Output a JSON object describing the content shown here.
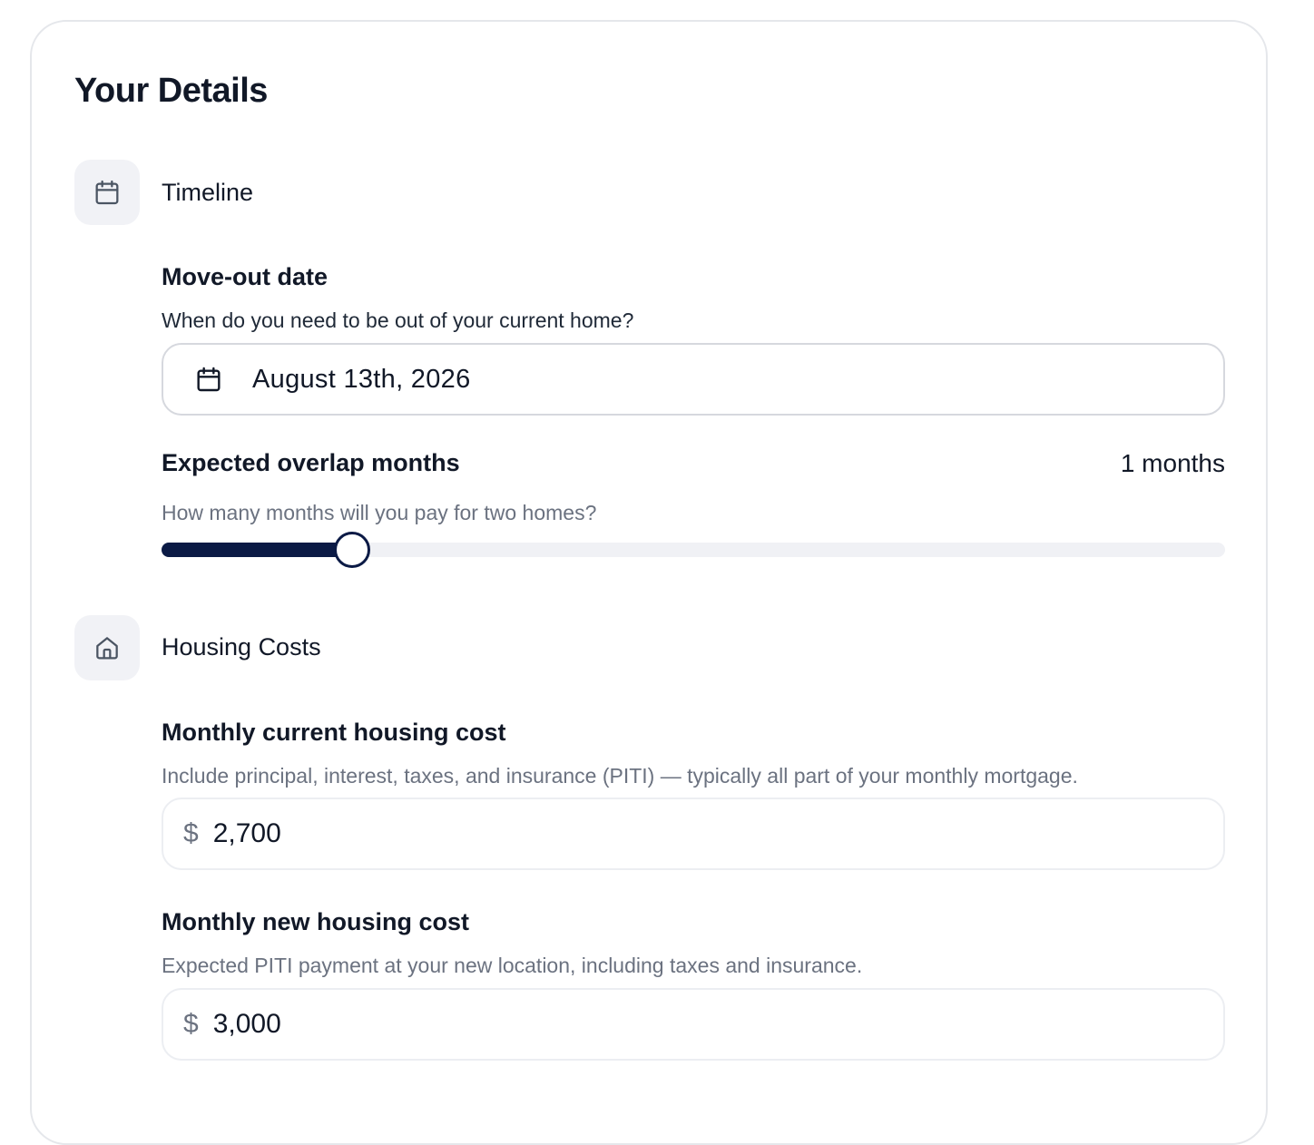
{
  "card": {
    "title": "Your Details"
  },
  "timeline": {
    "section_title": "Timeline",
    "icon": "calendar-icon",
    "move_out": {
      "label": "Move-out date",
      "help": "When do you need to be out of your current home?",
      "value": "August 13th, 2026",
      "icon": "calendar-icon"
    },
    "overlap": {
      "label": "Expected overlap months",
      "value_text": "1 months",
      "help": "How many months will you pay for two homes?",
      "slider_fraction": 0.179
    }
  },
  "housing": {
    "section_title": "Housing Costs",
    "icon": "home-icon",
    "current": {
      "label": "Monthly current housing cost",
      "help": "Include principal, interest, taxes, and insurance (PITI) — typically all part of your monthly mortgage.",
      "currency": "$",
      "value": "2,700"
    },
    "new": {
      "label": "Monthly new housing cost",
      "help": "Expected PITI payment at your new location, including taxes and insurance.",
      "currency": "$",
      "value": "3,000"
    }
  },
  "colors": {
    "accent": "#0b1a45",
    "icon_bg": "#f1f2f6",
    "muted_text": "#6b7280"
  }
}
